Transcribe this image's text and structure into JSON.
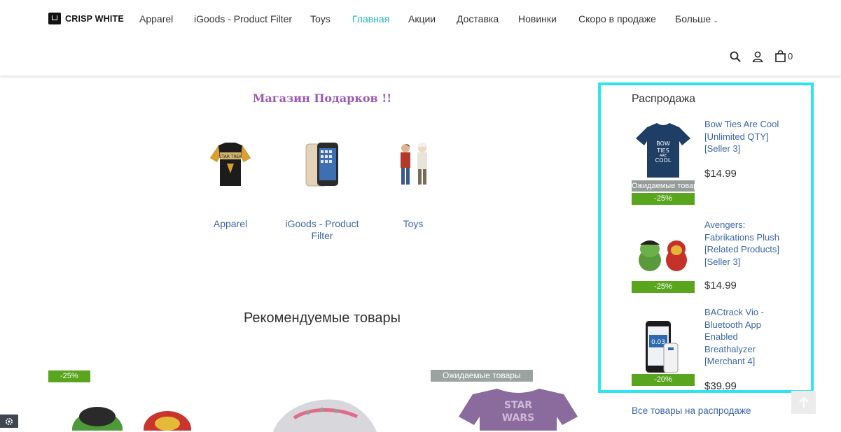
{
  "header": {
    "logo": "CRISP WHITE",
    "nav": [
      {
        "label": "Apparel"
      },
      {
        "label": "iGoods - Product Filter"
      },
      {
        "label": "Toys"
      },
      {
        "label": "Главная"
      },
      {
        "label": "Акции"
      },
      {
        "label": "Доставка"
      },
      {
        "label": "Новинки"
      },
      {
        "label": "Скоро в продаже"
      },
      {
        "label": "Больше"
      }
    ],
    "cart_count": "0",
    "accent_color": "#1fb5c3"
  },
  "main": {
    "shop_title": "Магазин Подарков !!",
    "categories": [
      {
        "label": "Apparel"
      },
      {
        "label": "iGoods - Product Filter"
      },
      {
        "label": "Toys"
      }
    ],
    "recommended_title": "Рекомендуемые товары",
    "products": [
      {
        "badge": "-25%"
      },
      {
        "badge": ""
      },
      {
        "badge": "Ожидаемые товары"
      }
    ]
  },
  "sale": {
    "title": "Распродажа",
    "items": [
      {
        "name": "Bow Ties Are Cool [Unlimited QTY] [Seller 3]",
        "price": "$14.99",
        "status": "Ожидаемые товары",
        "discount": "-25%"
      },
      {
        "name": "Avengers: Fabrikations Plush [Related Products] [Seller 3]",
        "price": "$14.99",
        "discount": "-25%"
      },
      {
        "name": "BACtrack Vio - Bluetooth App Enabled Breathalyzer [Merchant 4]",
        "price": "$39.99",
        "discount": "-20%"
      }
    ],
    "all_link": "Все товары на распродаже",
    "border_color": "#2ee4ee"
  }
}
